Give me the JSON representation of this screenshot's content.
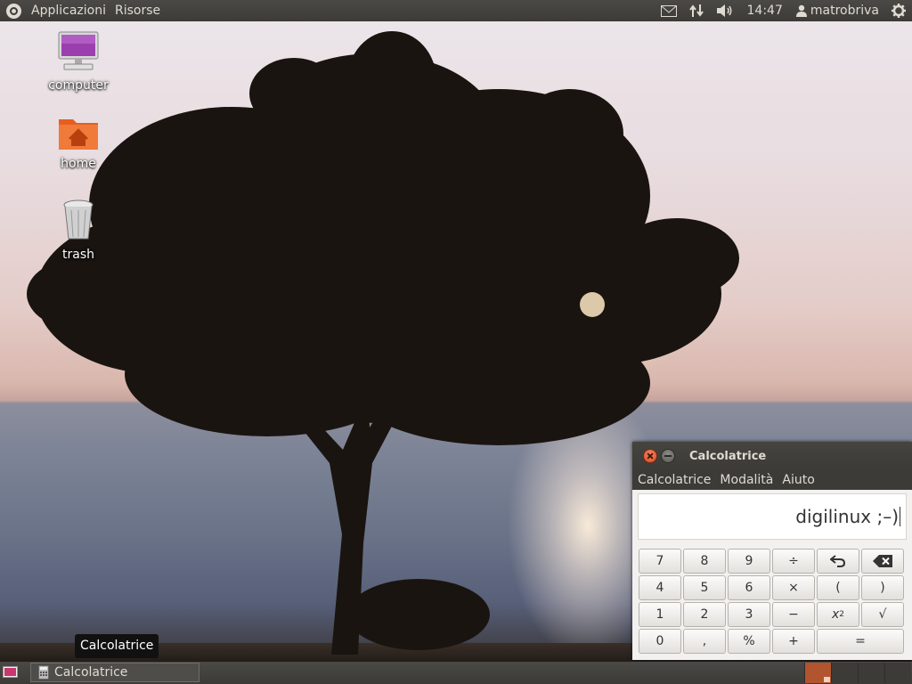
{
  "top_panel": {
    "menus": [
      "Applicazioni",
      "Risorse"
    ],
    "clock": "14:47",
    "user": "matrobriva",
    "icons": [
      "ubuntu-logo-icon",
      "mail-icon",
      "network-icon",
      "volume-icon",
      "user-icon",
      "session-gear-icon"
    ]
  },
  "desktop": {
    "icons": [
      {
        "label": "computer",
        "icon": "computer-icon"
      },
      {
        "label": "home",
        "icon": "home-folder-icon"
      },
      {
        "label": "trash",
        "icon": "trash-icon"
      }
    ]
  },
  "tooltip": "Calcolatrice",
  "calculator": {
    "title": "Calcolatrice",
    "menus": [
      "Calcolatrice",
      "Modalità",
      "Aiuto"
    ],
    "display": "digilinux ;–)",
    "keys": [
      [
        "7",
        "8",
        "9",
        "÷",
        "↶",
        "⌫"
      ],
      [
        "4",
        "5",
        "6",
        "×",
        "(",
        ")"
      ],
      [
        "1",
        "2",
        "3",
        "−",
        "x²",
        "√"
      ],
      [
        "0",
        ",",
        "%",
        "+",
        "="
      ]
    ]
  },
  "bottom_panel": {
    "task": "Calcolatrice",
    "workspaces": 4,
    "active_workspace": 1
  },
  "colors": {
    "panel": "#3c3b37",
    "panel_text": "#dfdbd2",
    "close_button": "#df4a1f",
    "workspace_active": "#b2542e"
  }
}
